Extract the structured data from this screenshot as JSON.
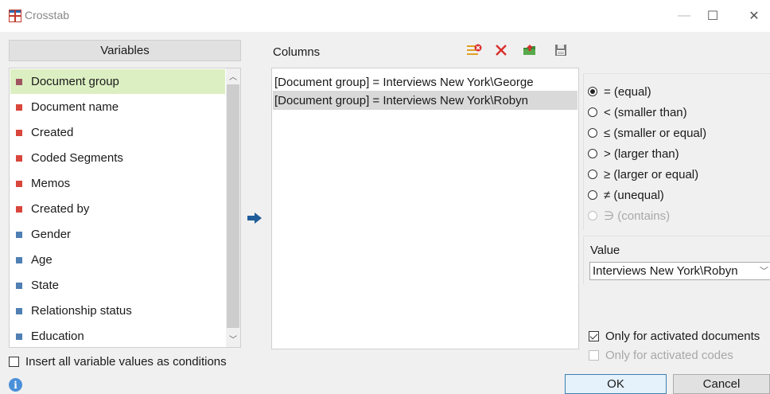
{
  "window": {
    "title": "Crosstab",
    "minimize_glyph": "—",
    "maximize_glyph": "☐",
    "close_glyph": "✕"
  },
  "variables": {
    "header": "Variables",
    "items": [
      {
        "label": "Document group",
        "color": "#a0545f",
        "selected": true
      },
      {
        "label": "Document name",
        "color": "#d9463c"
      },
      {
        "label": "Created",
        "color": "#d9463c"
      },
      {
        "label": "Coded Segments",
        "color": "#d9463c"
      },
      {
        "label": "Memos",
        "color": "#d9463c"
      },
      {
        "label": "Created by",
        "color": "#d9463c"
      },
      {
        "label": "Gender",
        "color": "#4f7fb3"
      },
      {
        "label": "Age",
        "color": "#4f7fb3"
      },
      {
        "label": "State",
        "color": "#4f7fb3"
      },
      {
        "label": "Relationship status",
        "color": "#4f7fb3"
      },
      {
        "label": "Education",
        "color": "#4f7fb3"
      }
    ],
    "insert_all_label": "Insert all variable values as conditions",
    "insert_all_checked": false
  },
  "columns": {
    "label": "Columns",
    "items": [
      {
        "text": "[Document group] = Interviews New York\\George"
      },
      {
        "text": "[Document group] = Interviews New York\\Robyn",
        "selected": true
      }
    ]
  },
  "operators": [
    {
      "label": "= (equal)",
      "checked": true
    },
    {
      "label": "< (smaller than)"
    },
    {
      "label": "≤ (smaller or equal)"
    },
    {
      "label": "> (larger than)"
    },
    {
      "label": "≥ (larger or equal)"
    },
    {
      "label": "≠ (unequal)"
    },
    {
      "label": "∋ (contains)",
      "disabled": true
    }
  ],
  "value": {
    "label": "Value",
    "selected": "Interviews New York\\Robyn"
  },
  "options": {
    "only_activated_documents": "Only for activated documents",
    "only_activated_documents_checked": true,
    "only_activated_codes": "Only for activated codes",
    "only_activated_codes_checked": false
  },
  "buttons": {
    "ok": "OK",
    "cancel": "Cancel"
  },
  "colors": {
    "selected_row_green": "#dcefc2",
    "selected_row_gray": "#d9d9d9",
    "arrow_blue": "#1f5c99"
  }
}
